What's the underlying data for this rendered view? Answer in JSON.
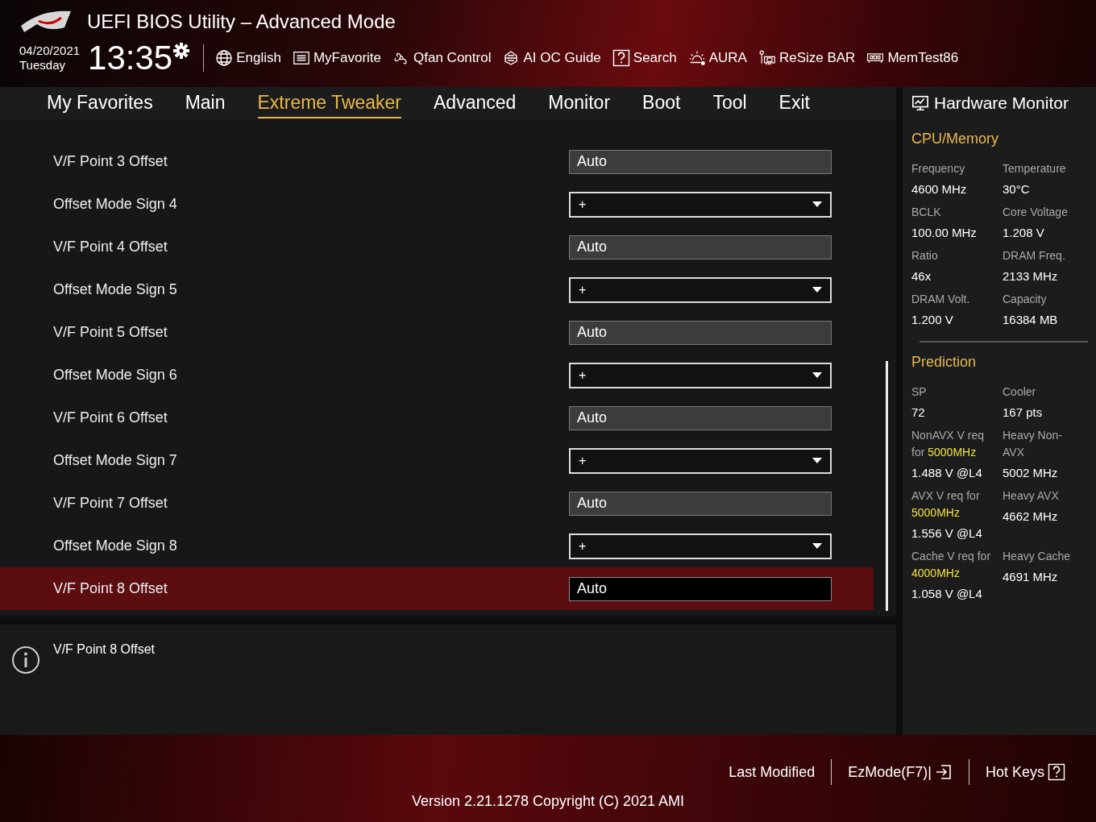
{
  "header": {
    "title": "UEFI BIOS Utility – Advanced Mode",
    "date": "04/20/2021",
    "weekday": "Tuesday",
    "time": "13:35",
    "tools": [
      {
        "label": "English"
      },
      {
        "label": "MyFavorite"
      },
      {
        "label": "Qfan Control"
      },
      {
        "label": "AI OC Guide"
      },
      {
        "label": "Search"
      },
      {
        "label": "AURA"
      },
      {
        "label": "ReSize BAR"
      },
      {
        "label": "MemTest86"
      }
    ]
  },
  "tabs": [
    {
      "label": "My Favorites",
      "selected": false
    },
    {
      "label": "Main",
      "selected": false
    },
    {
      "label": "Extreme Tweaker",
      "selected": true
    },
    {
      "label": "Advanced",
      "selected": false
    },
    {
      "label": "Monitor",
      "selected": false
    },
    {
      "label": "Boot",
      "selected": false
    },
    {
      "label": "Tool",
      "selected": false
    },
    {
      "label": "Exit",
      "selected": false
    }
  ],
  "settings": [
    {
      "label": "V/F Point 3 Offset",
      "kind": "field",
      "value": "Auto",
      "selected": false
    },
    {
      "label": "Offset Mode Sign 4",
      "kind": "dropdown",
      "value": "+",
      "selected": false
    },
    {
      "label": "V/F Point 4 Offset",
      "kind": "field",
      "value": "Auto",
      "selected": false
    },
    {
      "label": "Offset Mode Sign 5",
      "kind": "dropdown",
      "value": "+",
      "selected": false
    },
    {
      "label": "V/F Point 5 Offset",
      "kind": "field",
      "value": "Auto",
      "selected": false
    },
    {
      "label": "Offset Mode Sign 6",
      "kind": "dropdown",
      "value": "+",
      "selected": false
    },
    {
      "label": "V/F Point 6 Offset",
      "kind": "field",
      "value": "Auto",
      "selected": false
    },
    {
      "label": "Offset Mode Sign 7",
      "kind": "dropdown",
      "value": "+",
      "selected": false
    },
    {
      "label": "V/F Point 7 Offset",
      "kind": "field",
      "value": "Auto",
      "selected": false
    },
    {
      "label": "Offset Mode Sign 8",
      "kind": "dropdown",
      "value": "+",
      "selected": false
    },
    {
      "label": "V/F Point 8 Offset",
      "kind": "field",
      "value": "Auto",
      "selected": true
    }
  ],
  "help": {
    "text": "V/F Point 8 Offset"
  },
  "hardware_monitor": {
    "title": "Hardware Monitor",
    "sections": [
      {
        "title": "CPU/Memory",
        "items": [
          {
            "label": [
              {
                "text": "Frequency"
              }
            ],
            "value": "4600 MHz"
          },
          {
            "label": [
              {
                "text": "Temperature"
              }
            ],
            "value": "30°C"
          },
          {
            "label": [
              {
                "text": "BCLK"
              }
            ],
            "value": "100.00 MHz"
          },
          {
            "label": [
              {
                "text": "Core Voltage"
              }
            ],
            "value": "1.208 V"
          },
          {
            "label": [
              {
                "text": "Ratio"
              }
            ],
            "value": "46x"
          },
          {
            "label": [
              {
                "text": "DRAM Freq."
              }
            ],
            "value": "2133 MHz"
          },
          {
            "label": [
              {
                "text": "DRAM Volt."
              }
            ],
            "value": "1.200 V"
          },
          {
            "label": [
              {
                "text": "Capacity"
              }
            ],
            "value": "16384 MB"
          }
        ]
      },
      {
        "title": "Prediction",
        "items": [
          {
            "label": [
              {
                "text": "SP"
              }
            ],
            "value": "72"
          },
          {
            "label": [
              {
                "text": "Cooler"
              }
            ],
            "value": "167 pts"
          },
          {
            "label": [
              {
                "text": "NonAVX V req for "
              },
              {
                "text": "5000MHz",
                "highlight": true
              }
            ],
            "value": "1.488 V @L4"
          },
          {
            "label": [
              {
                "text": "Heavy Non-AVX"
              }
            ],
            "value": "5002 MHz"
          },
          {
            "label": [
              {
                "text": "AVX V req for "
              },
              {
                "text": "5000MHz",
                "highlight": true
              }
            ],
            "value": "1.556 V @L4"
          },
          {
            "label": [
              {
                "text": "Heavy AVX"
              }
            ],
            "value": "4662 MHz"
          },
          {
            "label": [
              {
                "text": "Cache V req for "
              },
              {
                "text": "4000MHz",
                "highlight": true
              }
            ],
            "value": "1.058 V @L4"
          },
          {
            "label": [
              {
                "text": "Heavy Cache"
              }
            ],
            "value": "4691 MHz"
          }
        ]
      }
    ]
  },
  "footer": {
    "version": "Version 2.21.1278 Copyright (C) 2021 AMI",
    "buttons": [
      {
        "label": "Last Modified"
      },
      {
        "label": "EzMode(F7)|"
      },
      {
        "label": "Hot Keys"
      }
    ]
  }
}
